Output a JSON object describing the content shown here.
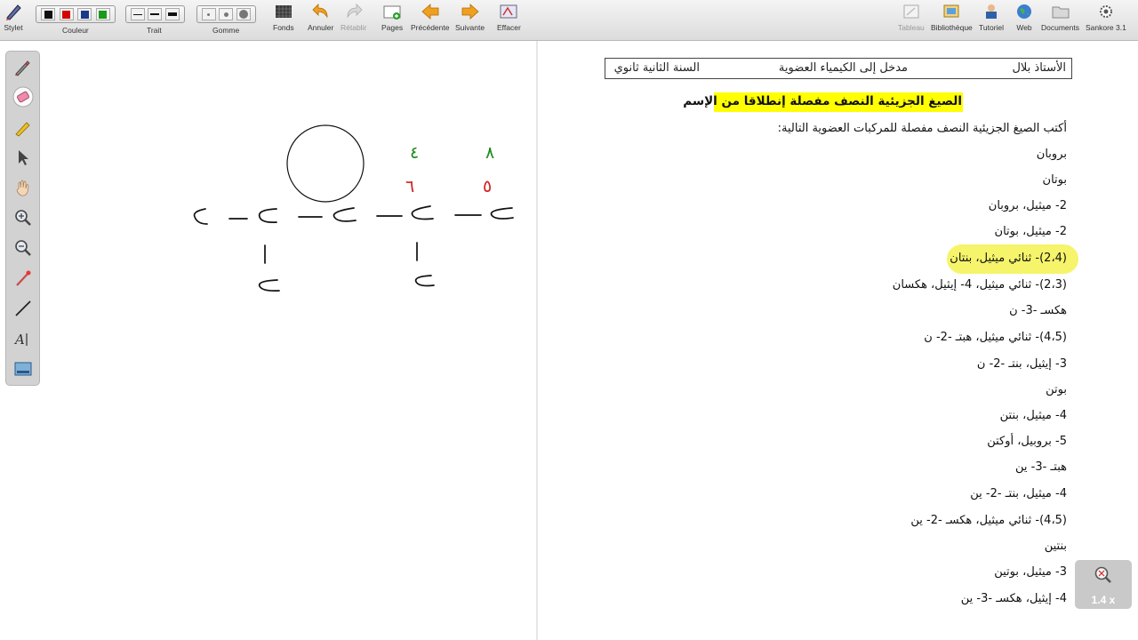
{
  "toolbar": {
    "stylet": "Stylet",
    "couleur": "Couleur",
    "trait": "Trait",
    "gomme": "Gomme",
    "fonds": "Fonds",
    "annuler": "Annuler",
    "retablir": "Rétablir",
    "pages": "Pages",
    "precedente": "Précédente",
    "suivante": "Suivante",
    "effacer": "Effacer",
    "tableau": "Tableau",
    "bibliotheque": "Bibliothèque",
    "tutoriel": "Tutoriel",
    "web": "Web",
    "documents": "Documents",
    "sankore": "Sankore 3.1",
    "colors": [
      "#111111",
      "#d40000",
      "#1a3a8a",
      "#1a9a1a"
    ]
  },
  "palette": {
    "tools": [
      "pen-icon",
      "eraser-icon",
      "marker-icon",
      "select-arrow-icon",
      "hand-icon",
      "zoom-in-icon",
      "zoom-out-icon",
      "pointer-laser-icon",
      "line-icon",
      "text-icon",
      "capture-icon"
    ]
  },
  "document": {
    "teacher": "الأستاذ بلال",
    "subject": "مدخل إلى الكيمياء العضوية",
    "level": "السنة الثانية ثانوي",
    "title": "الصيغ الجزيئية النصف مفصلة إنطلاقا من الإسم",
    "instruction": "أكتب الصيغ الجزيئية النصف مفصلة للمركبات العضوية التالية:",
    "items": [
      "بروبان",
      "بوتان",
      "2- ميثيل، بروبان",
      "2- ميثيل، بوتان",
      "(2،4)- ثنائي ميثيل، بنتان",
      "(2،3)- ثنائي ميثيل، 4- إيثيل، هكسان",
      "هكسـ -3- ن",
      "(4،5)- ثنائي ميثيل، هبتـ -2- ن",
      "3- إيثيل، بنتـ -2- ن",
      "بوتن",
      "4- ميثيل، بنتن",
      "5- بروبيل، أوكتن",
      "هبتـ -3- ين",
      "4- ميثيل، بنتـ -2- ين",
      "(4،5)- ثنائي ميثيل، هكسـ -2- ين",
      "بنتين",
      "3- ميثيل، بوتين",
      "4- إيثيل، هكسـ -3- ين"
    ]
  },
  "whiteboard": {
    "numbers": [
      "٨",
      "٤",
      "٥",
      "٦",
      "١",
      "١"
    ]
  },
  "zoom": {
    "level": "1.4 x"
  }
}
